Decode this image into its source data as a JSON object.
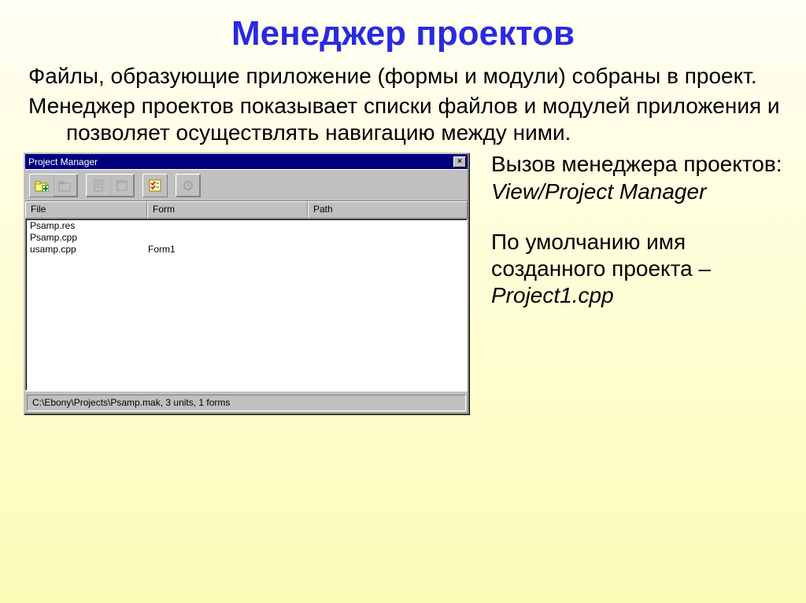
{
  "slide": {
    "title": "Менеджер проектов",
    "para1": "Файлы, образующие приложение (формы и модули) собраны в проект.",
    "para2": "Менеджер проектов показывает списки файлов и модулей приложения и позволяет осуществлять навигацию между ними.",
    "right1_a": "Вызов менеджера проектов:",
    "right1_b": "View/Project Manager",
    "right2_a": "По умолчанию имя созданного проекта – ",
    "right2_b": "Project1.cpp"
  },
  "pm": {
    "title": "Project Manager",
    "close": "×",
    "toolbar": {
      "add": "add-unit-icon",
      "remove": "remove-unit-icon",
      "view_unit": "view-unit-icon",
      "view_form": "view-form-icon",
      "options": "options-icon",
      "update": "update-icon"
    },
    "headers": {
      "file": "File",
      "form": "Form",
      "path": "Path"
    },
    "rows": [
      {
        "file": "Psamp.res",
        "form": "",
        "path": ""
      },
      {
        "file": "Psamp.cpp",
        "form": "",
        "path": ""
      },
      {
        "file": "usamp.cpp",
        "form": "Form1",
        "path": ""
      }
    ],
    "status": "C:\\Ebony\\Projects\\Psamp.mak, 3 units, 1 forms"
  }
}
